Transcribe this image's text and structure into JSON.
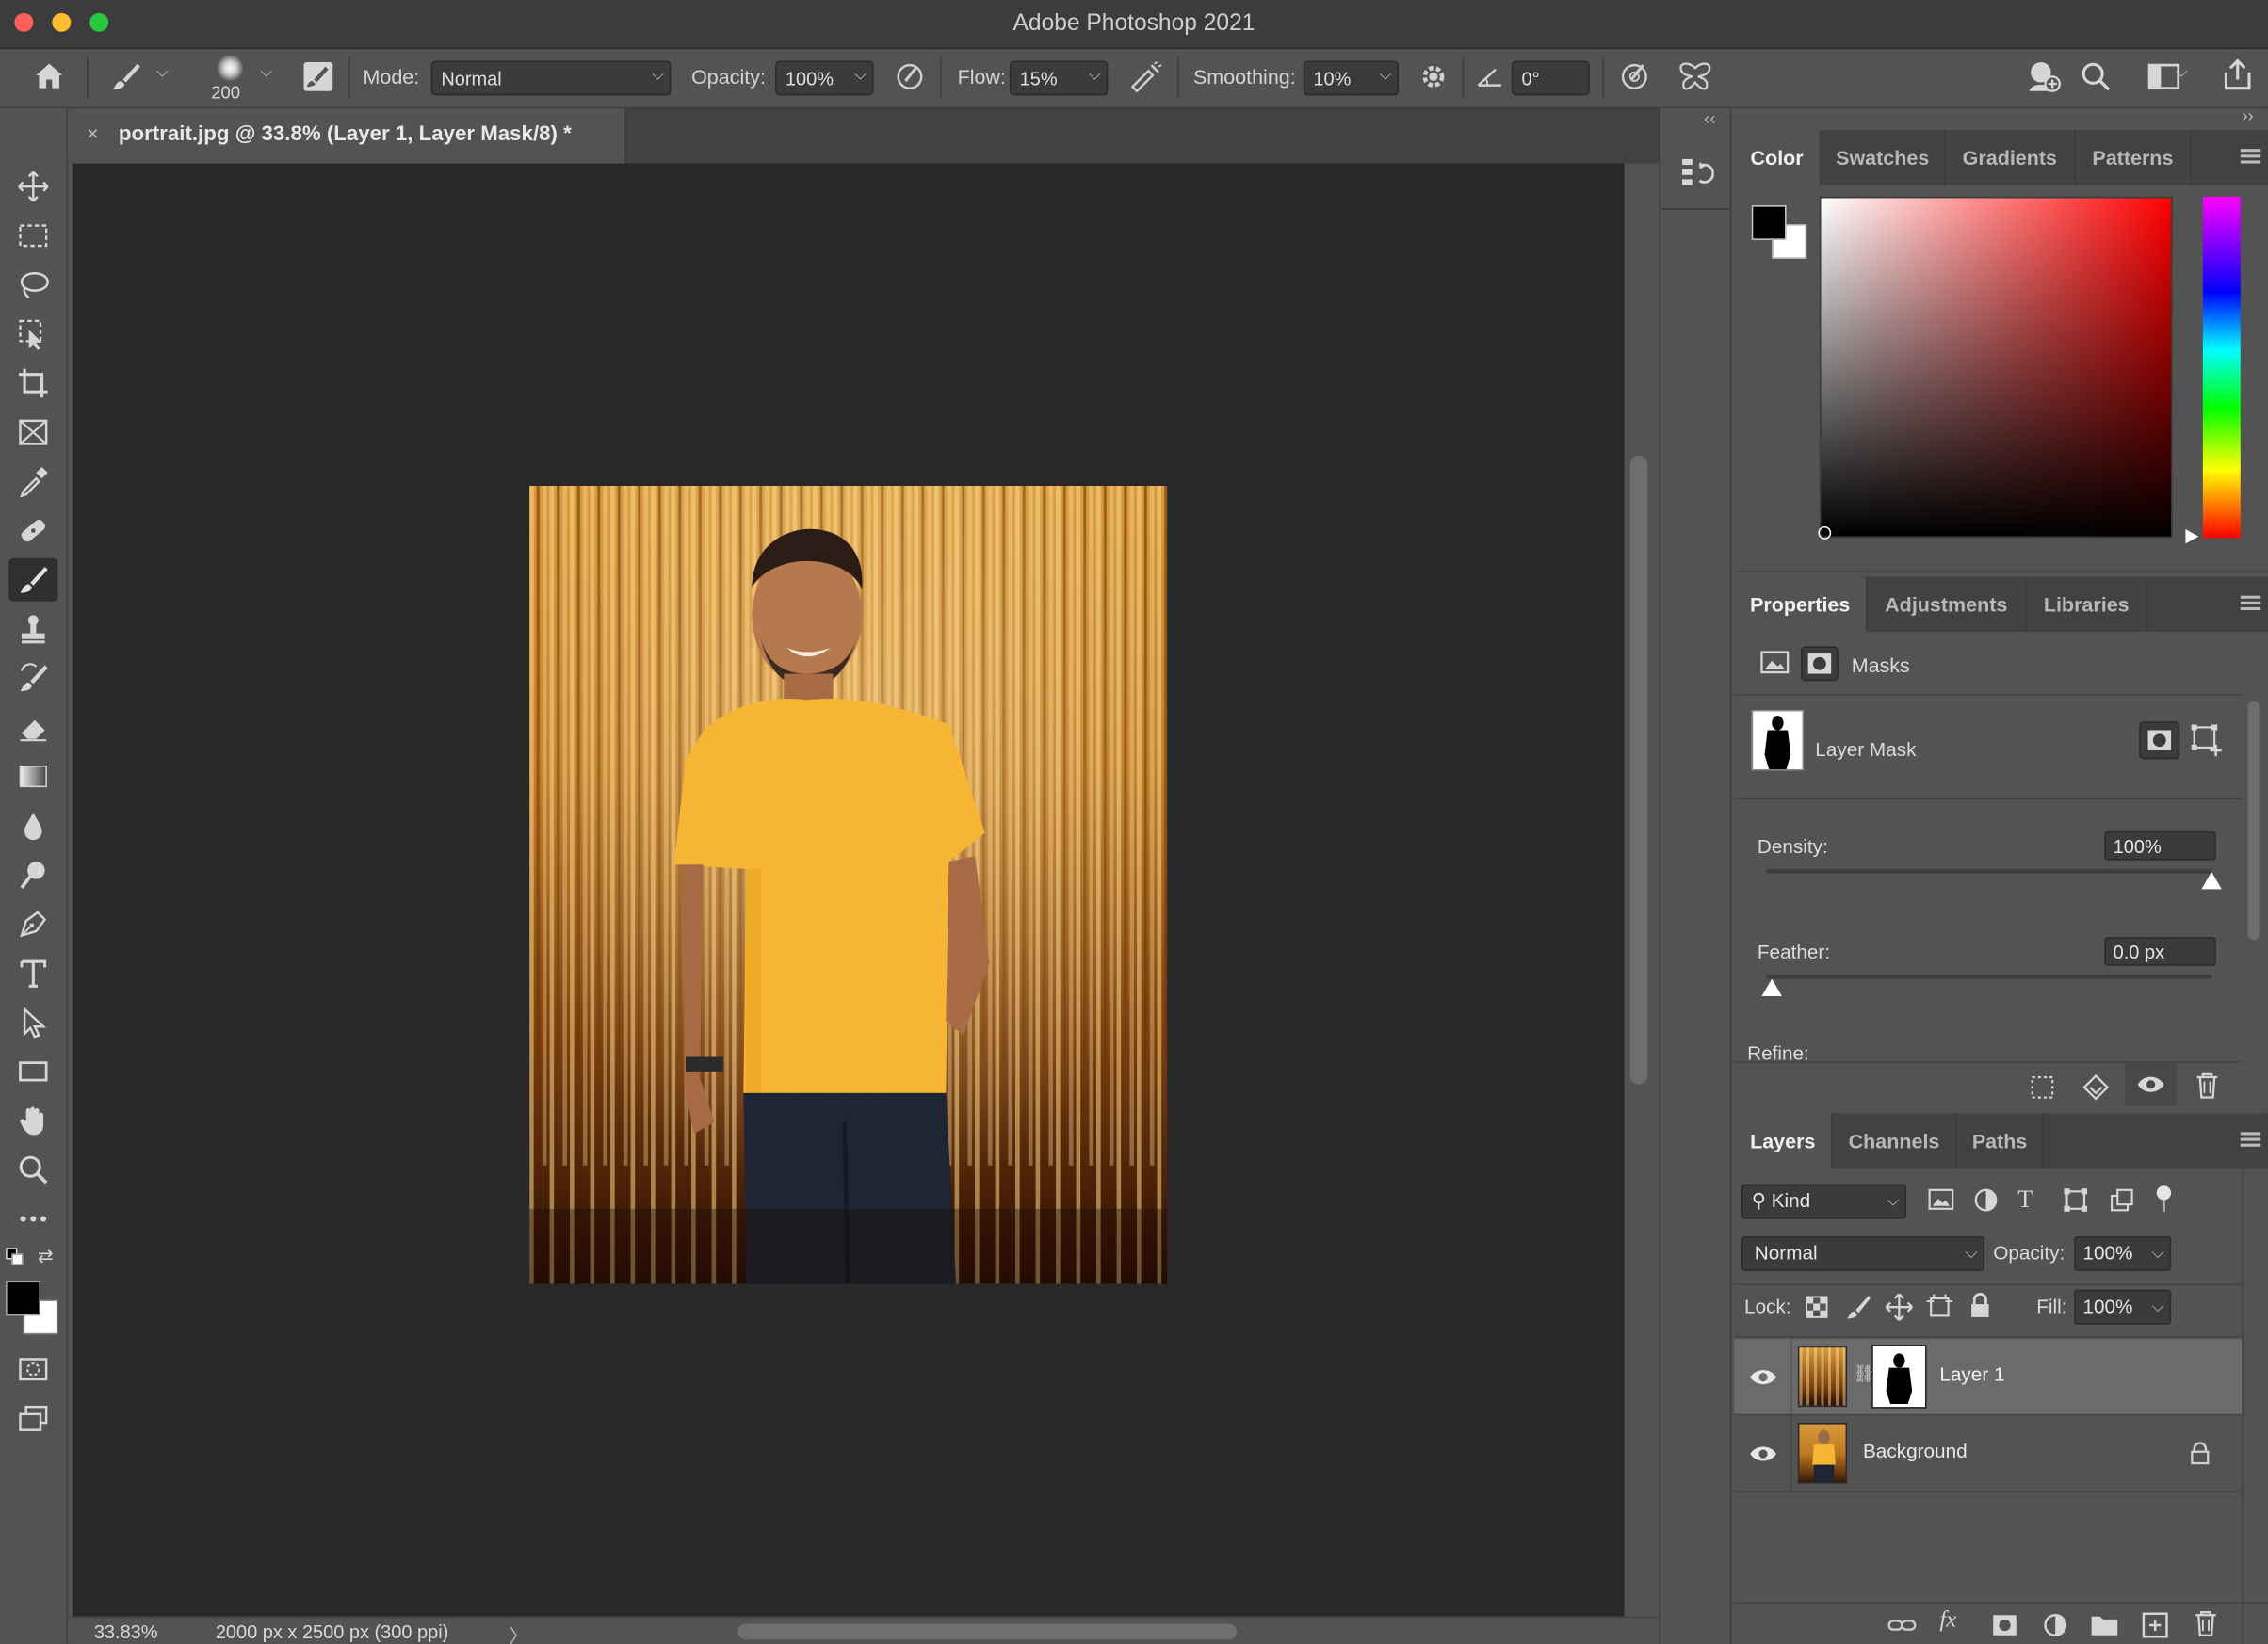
{
  "app": {
    "title": "Adobe Photoshop 2021",
    "expand_left": "››",
    "expand_right": "››",
    "collapse": "‹‹"
  },
  "options": {
    "brush_size": "200",
    "mode_label": "Mode:",
    "mode_value": "Normal",
    "opacity_label": "Opacity:",
    "opacity_value": "100%",
    "flow_label": "Flow:",
    "flow_value": "15%",
    "smoothing_label": "Smoothing:",
    "smoothing_value": "10%",
    "angle_value": "0°"
  },
  "document": {
    "tab_title": "portrait.jpg @ 33.8% (Layer 1, Layer Mask/8) *",
    "close_glyph": "×",
    "zoom": "33.83%",
    "dimensions": "2000 px x 2500 px (300 ppi)",
    "status_arrow": "〉"
  },
  "color_panel": {
    "tabs": [
      "Color",
      "Swatches",
      "Gradients",
      "Patterns"
    ],
    "foreground": "#000000",
    "background": "#ffffff",
    "hue": "#ff0000"
  },
  "properties_panel": {
    "tabs": [
      "Properties",
      "Adjustments",
      "Libraries"
    ],
    "section": "Masks",
    "mask_name": "Layer Mask",
    "density_label": "Density:",
    "density_value": "100%",
    "density_level": 1.0,
    "feather_label": "Feather:",
    "feather_value": "0.0 px",
    "feather_level": 0.0,
    "refine_label": "Refine:"
  },
  "layers_panel": {
    "tabs": [
      "Layers",
      "Channels",
      "Paths"
    ],
    "filter_kind": "Kind",
    "blend_mode": "Normal",
    "opacity_label": "Opacity:",
    "opacity_value": "100%",
    "lock_label": "Lock:",
    "fill_label": "Fill:",
    "fill_value": "100%",
    "layers": [
      {
        "name": "Layer 1",
        "visible": true,
        "has_mask": true,
        "selected": true
      },
      {
        "name": "Background",
        "visible": true,
        "locked": true
      }
    ],
    "fx_label": "fx"
  }
}
